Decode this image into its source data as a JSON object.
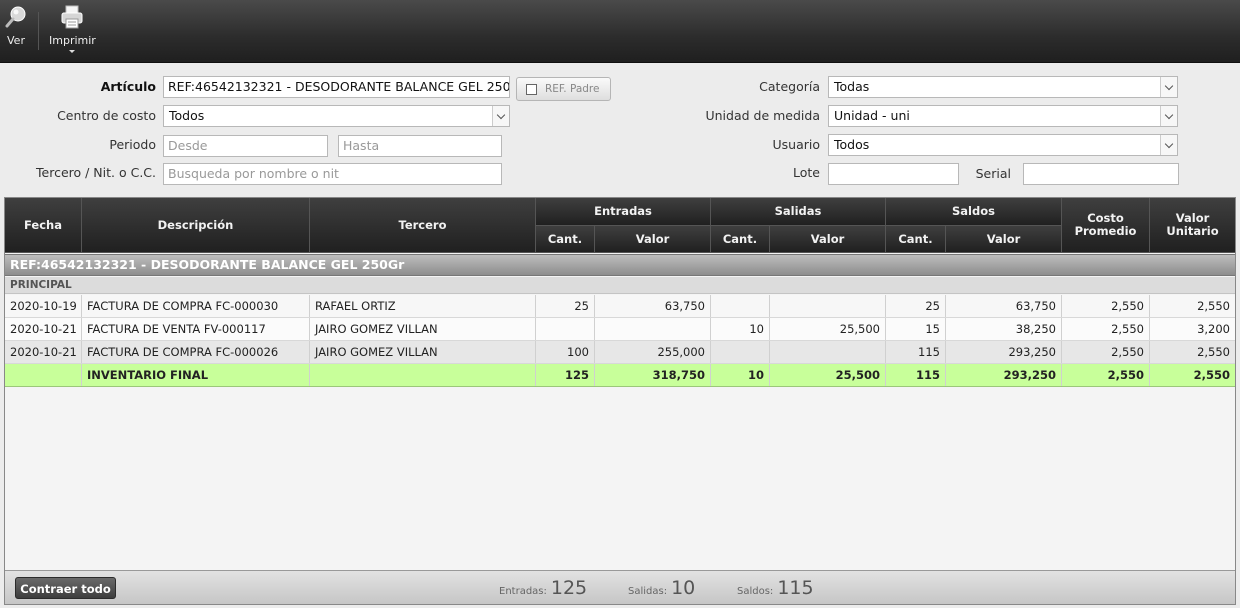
{
  "toolbar": {
    "view_label": "Ver",
    "print_label": "Imprimir"
  },
  "filters": {
    "articulo_label": "Artículo",
    "articulo_value": "REF:46542132321 - DESODORANTE BALANCE GEL 250Gr",
    "ref_padre_label": "REF. Padre",
    "centro_label": "Centro de costo",
    "centro_value": "Todos",
    "periodo_label": "Periodo",
    "desde_placeholder": "Desde",
    "hasta_placeholder": "Hasta",
    "tercero_label": "Tercero / Nit. o C.C.",
    "tercero_placeholder": "Busqueda por nombre o nit",
    "categoria_label": "Categoría",
    "categoria_value": "Todas",
    "unidad_label": "Unidad de medida",
    "unidad_value": "Unidad - uni",
    "usuario_label": "Usuario",
    "usuario_value": "Todos",
    "lote_label": "Lote",
    "serial_label": "Serial"
  },
  "grid": {
    "headers": {
      "fecha": "Fecha",
      "descripcion": "Descripción",
      "tercero": "Tercero",
      "entradas": "Entradas",
      "salidas": "Salidas",
      "saldos": "Saldos",
      "cant": "Cant.",
      "valor": "Valor",
      "costo_promedio": "Costo Promedio",
      "valor_unitario": "Valor Unitario"
    },
    "group_title": "REF:46542132321 - DESODORANTE BALANCE GEL 250Gr",
    "subgroup_title": "PRINCIPAL",
    "rows": [
      {
        "fecha": "2020-10-19",
        "descripcion": "FACTURA DE COMPRA FC-000030",
        "tercero": "RAFAEL ORTIZ",
        "ent_cant": "25",
        "ent_valor": "63,750",
        "sal_cant": "",
        "sal_valor": "",
        "sdo_cant": "25",
        "sdo_valor": "63,750",
        "costo": "2,550",
        "unitario": "2,550"
      },
      {
        "fecha": "2020-10-21",
        "descripcion": "FACTURA DE VENTA FV-000117",
        "tercero": "JAIRO GOMEZ VILLAN",
        "ent_cant": "",
        "ent_valor": "",
        "sal_cant": "10",
        "sal_valor": "25,500",
        "sdo_cant": "15",
        "sdo_valor": "38,250",
        "costo": "2,550",
        "unitario": "3,200"
      },
      {
        "fecha": "2020-10-21",
        "descripcion": "FACTURA DE COMPRA FC-000026",
        "tercero": "JAIRO GOMEZ VILLAN",
        "ent_cant": "100",
        "ent_valor": "255,000",
        "sal_cant": "",
        "sal_valor": "",
        "sdo_cant": "115",
        "sdo_valor": "293,250",
        "costo": "2,550",
        "unitario": "2,550"
      }
    ],
    "total": {
      "fecha": "",
      "descripcion": "INVENTARIO FINAL",
      "tercero": "",
      "ent_cant": "125",
      "ent_valor": "318,750",
      "sal_cant": "10",
      "sal_valor": "25,500",
      "sdo_cant": "115",
      "sdo_valor": "293,250",
      "costo": "2,550",
      "unitario": "2,550"
    }
  },
  "footer": {
    "collapse_label": "Contraer todo",
    "entradas_label": "Entradas:",
    "entradas_value": "125",
    "salidas_label": "Salidas:",
    "salidas_value": "10",
    "saldos_label": "Saldos:",
    "saldos_value": "115"
  },
  "colors": {
    "toolbar_bg": "#2c2c2c",
    "total_row": "#c8ff9a",
    "header_bg": "#2a2a2a"
  },
  "icons": {
    "view": "magnifier-icon",
    "print": "printer-icon"
  }
}
